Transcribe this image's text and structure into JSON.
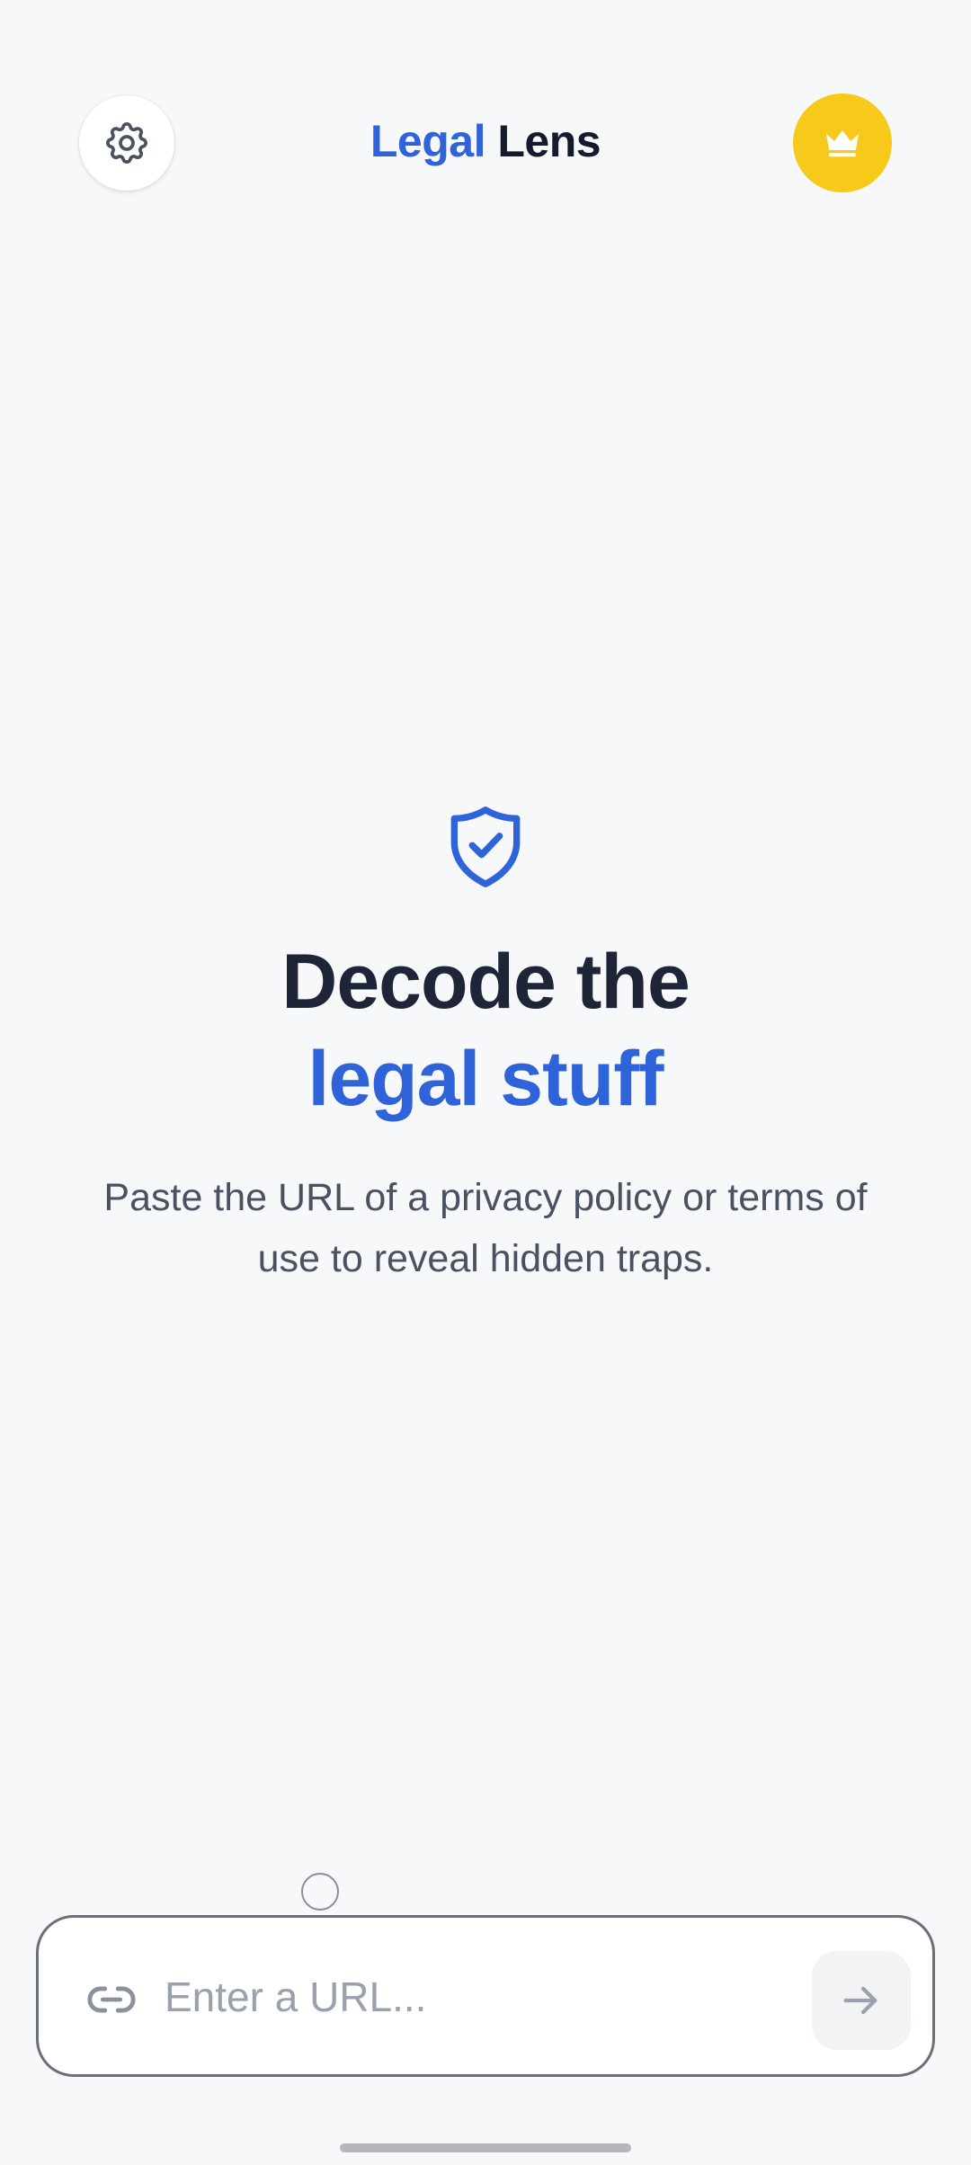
{
  "header": {
    "title_part1": "Legal",
    "title_part2": "Lens",
    "settings_icon": "gear-icon",
    "premium_icon": "crown-icon"
  },
  "hero": {
    "icon": "shield-check-icon",
    "headline_line1": "Decode the",
    "headline_line2": "legal stuff",
    "subtitle": "Paste the URL of a privacy policy or terms of use to reveal hidden traps."
  },
  "url_bar": {
    "placeholder": "Enter a URL...",
    "value": "",
    "link_icon": "link-icon",
    "submit_icon": "arrow-right-icon"
  },
  "colors": {
    "accent": "#2f63d9",
    "premium": "#f7c91b",
    "heading": "#1d2536",
    "background": "#f7f8fa"
  }
}
